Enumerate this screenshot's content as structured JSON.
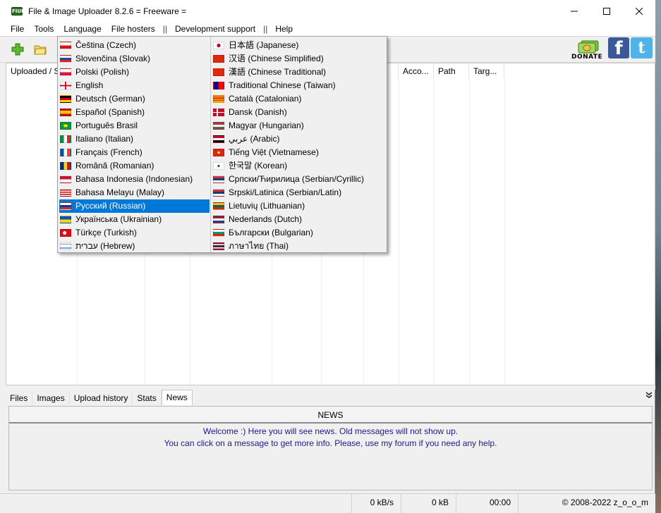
{
  "window": {
    "title": "File & Image Uploader 8.2.6  = Freeware =",
    "app_icon": "FIUP"
  },
  "menu": {
    "file": "File",
    "tools": "Tools",
    "language": "Language",
    "file_hosters": "File hosters",
    "sep1": "||",
    "dev_support": "Development support",
    "sep2": "||",
    "help": "Help"
  },
  "toolbar": {
    "donate_label": "DONATE",
    "fb_glyph": "f",
    "tw_glyph": "t"
  },
  "columns": {
    "uploaded_size": "Uploaded / Size",
    "account": "Acco...",
    "path": "Path",
    "target": "Targ..."
  },
  "tabs": {
    "files": "Files",
    "images": "Images",
    "upload_history": "Upload history",
    "stats": "Stats",
    "news": "News"
  },
  "news": {
    "header": "NEWS",
    "line1": "Welcome :) Here you will see news. Old messages will not show up.",
    "line2": "You can click on a message to get more info. Please, use my forum if you need any help."
  },
  "status": {
    "speed": "0 kB/s",
    "size": "0 kB",
    "time": "00:00",
    "copyright": "© 2008-2022 z_o_o_m"
  },
  "languages_left": [
    {
      "label": "Čeština (Czech)",
      "flag": "cz"
    },
    {
      "label": "Slovenčina (Slovak)",
      "flag": "sk"
    },
    {
      "label": "Polski (Polish)",
      "flag": "pl"
    },
    {
      "label": "English",
      "flag": "gb"
    },
    {
      "label": "Deutsch (German)",
      "flag": "de"
    },
    {
      "label": "Español (Spanish)",
      "flag": "es"
    },
    {
      "label": "Português Brasil",
      "flag": "br"
    },
    {
      "label": "Italiano (Italian)",
      "flag": "it"
    },
    {
      "label": "Français (French)",
      "flag": "fr"
    },
    {
      "label": "Română (Romanian)",
      "flag": "ro"
    },
    {
      "label": "Bahasa Indonesia (Indonesian)",
      "flag": "id"
    },
    {
      "label": "Bahasa Melayu (Malay)",
      "flag": "my"
    },
    {
      "label": "Русский (Russian)",
      "flag": "ru"
    },
    {
      "label": "Українська (Ukrainian)",
      "flag": "ua"
    },
    {
      "label": "Türkçe (Turkish)",
      "flag": "tr"
    },
    {
      "label": "עברית (Hebrew)",
      "flag": "il"
    }
  ],
  "languages_right": [
    {
      "label": "日本語 (Japanese)",
      "flag": "jp"
    },
    {
      "label": "汉语 (Chinese Simplified)",
      "flag": "cn"
    },
    {
      "label": "漢語 (Chinese Traditional)",
      "flag": "cn"
    },
    {
      "label": "Traditional Chinese (Taiwan)",
      "flag": "tw"
    },
    {
      "label": "Català (Catalonian)",
      "flag": "cat"
    },
    {
      "label": "Dansk (Danish)",
      "flag": "dk"
    },
    {
      "label": "Magyar (Hungarian)",
      "flag": "hu"
    },
    {
      "label": "عربي (Arabic)",
      "flag": "ar"
    },
    {
      "label": "Tiếng Việt (Vietnamese)",
      "flag": "vn"
    },
    {
      "label": "한국말 (Korean)",
      "flag": "kr"
    },
    {
      "label": "Српски/Ћирилица (Serbian/Cyrillic)",
      "flag": "rs"
    },
    {
      "label": "Srpski/Latinica (Serbian/Latin)",
      "flag": "rs"
    },
    {
      "label": "Lietuvių (Lithuanian)",
      "flag": "lt"
    },
    {
      "label": "Nederlands (Dutch)",
      "flag": "nl"
    },
    {
      "label": "Български (Bulgarian)",
      "flag": "bg"
    },
    {
      "label": "ภาษาไทย (Thai)",
      "flag": "th"
    }
  ],
  "selected_language": "Русский (Russian)",
  "colors": {
    "selection": "#0078d7",
    "news_text": "#1a1a8c"
  }
}
